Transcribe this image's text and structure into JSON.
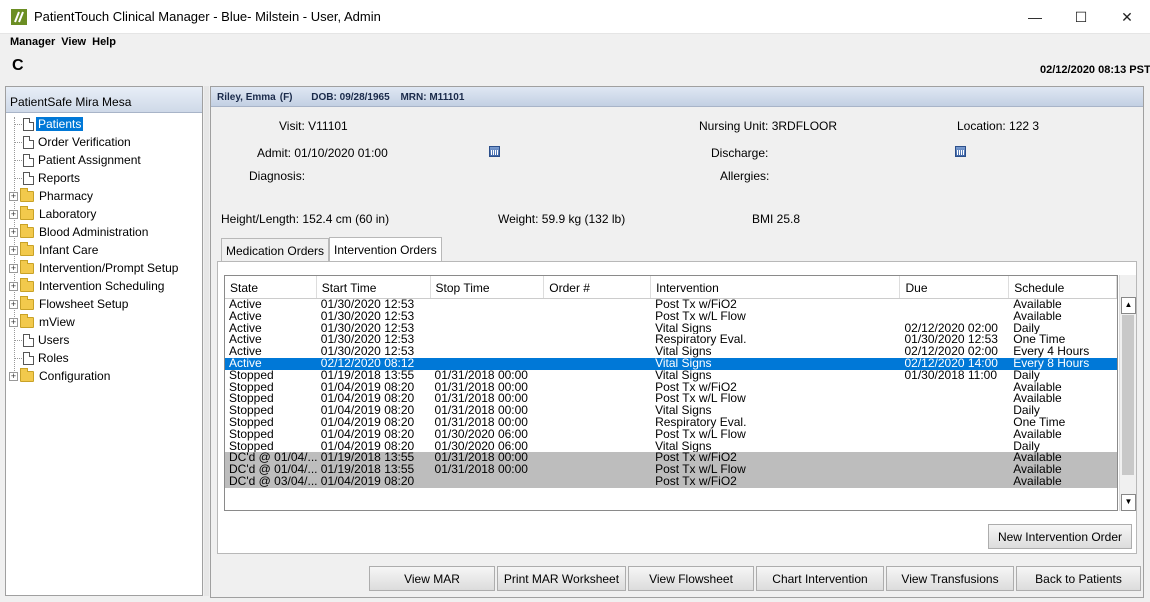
{
  "window": {
    "title": "PatientTouch Clinical Manager - Blue- Milstein - User, Admin",
    "minimize": "—",
    "maximize": "☐",
    "close": "✕"
  },
  "menu": [
    "Manager",
    "View",
    "Help"
  ],
  "toolbar": {
    "refresh_icon": "C",
    "datetime": "02/12/2020 08:13 PST"
  },
  "sidebar": {
    "header": "PatientSafe Mira Mesa",
    "items": [
      {
        "label": "Patients",
        "kind": "doc",
        "selected": true
      },
      {
        "label": "Order Verification",
        "kind": "doc"
      },
      {
        "label": "Patient Assignment",
        "kind": "doc"
      },
      {
        "label": "Reports",
        "kind": "doc"
      },
      {
        "label": "Pharmacy",
        "kind": "folder"
      },
      {
        "label": "Laboratory",
        "kind": "folder"
      },
      {
        "label": "Blood Administration",
        "kind": "folder"
      },
      {
        "label": "Infant Care",
        "kind": "folder"
      },
      {
        "label": "Intervention/Prompt Setup",
        "kind": "folder"
      },
      {
        "label": "Intervention Scheduling",
        "kind": "folder"
      },
      {
        "label": "Flowsheet Setup",
        "kind": "folder"
      },
      {
        "label": "mView",
        "kind": "folder"
      },
      {
        "label": "Users",
        "kind": "doc"
      },
      {
        "label": "Roles",
        "kind": "doc"
      },
      {
        "label": "Configuration",
        "kind": "folder"
      }
    ]
  },
  "patient": {
    "name": "Riley, Emma",
    "sex": "(F)",
    "dob": "DOB: 09/28/1965",
    "mrn": "MRN: M11101",
    "visit": "Visit: V11101",
    "nursing_unit": "Nursing Unit: 3RDFLOOR",
    "location": "Location: 122 3",
    "admit": "Admit: 01/10/2020 01:00",
    "discharge": "Discharge:",
    "diagnosis": "Diagnosis:",
    "allergies": "Allergies:",
    "height": "Height/Length: 152.4 cm (60 in)",
    "weight": "Weight: 59.9 kg (132 lb)",
    "bmi": "BMI 25.8"
  },
  "tabs": [
    {
      "label": "Medication Orders",
      "active": false
    },
    {
      "label": "Intervention Orders",
      "active": true
    }
  ],
  "grid": {
    "columns": [
      "State",
      "Start Time",
      "Stop Time",
      "Order #",
      "Intervention",
      "Due",
      "Schedule"
    ],
    "rows": [
      {
        "cells": [
          "Active",
          "01/30/2020 12:53",
          "",
          "",
          "Post Tx w/FiO2",
          "",
          "Available"
        ]
      },
      {
        "cells": [
          "Active",
          "01/30/2020 12:53",
          "",
          "",
          "Post Tx w/L Flow",
          "",
          "Available"
        ]
      },
      {
        "cells": [
          "Active",
          "01/30/2020 12:53",
          "",
          "",
          "Vital Signs",
          "02/12/2020 02:00",
          "Daily"
        ]
      },
      {
        "cells": [
          "Active",
          "01/30/2020 12:53",
          "",
          "",
          "Respiratory Eval.",
          "01/30/2020 12:53",
          "One Time"
        ]
      },
      {
        "cells": [
          "Active",
          "01/30/2020 12:53",
          "",
          "",
          "Vital Signs",
          "02/12/2020 02:00",
          "Every  4 Hours"
        ]
      },
      {
        "cells": [
          "Active",
          "02/12/2020 08:12",
          "",
          "",
          "Vital Signs",
          "02/12/2020 14:00",
          "Every 8 Hours"
        ],
        "style": "sel"
      },
      {
        "cells": [
          "Stopped",
          "01/19/2018 13:55",
          "01/31/2018 00:00",
          "",
          "Vital Signs",
          "01/30/2018 11:00",
          "Daily"
        ]
      },
      {
        "cells": [
          "Stopped",
          "01/04/2019 08:20",
          "01/31/2018 00:00",
          "",
          "Post Tx w/FiO2",
          "",
          "Available"
        ]
      },
      {
        "cells": [
          "Stopped",
          "01/04/2019 08:20",
          "01/31/2018 00:00",
          "",
          "Post Tx w/L Flow",
          "",
          "Available"
        ]
      },
      {
        "cells": [
          "Stopped",
          "01/04/2019 08:20",
          "01/31/2018 00:00",
          "",
          "Vital Signs",
          "",
          "Daily"
        ]
      },
      {
        "cells": [
          "Stopped",
          "01/04/2019 08:20",
          "01/31/2018 00:00",
          "",
          "Respiratory Eval.",
          "",
          "One Time"
        ]
      },
      {
        "cells": [
          "Stopped",
          "01/04/2019 08:20",
          "01/30/2020 06:00",
          "",
          "Post Tx w/L Flow",
          "",
          "Available"
        ]
      },
      {
        "cells": [
          "Stopped",
          "01/04/2019 08:20",
          "01/30/2020 06:00",
          "",
          "Vital Signs",
          "",
          "Daily"
        ]
      },
      {
        "cells": [
          "DC'd @ 01/04/...",
          "01/19/2018 13:55",
          "01/31/2018 00:00",
          "",
          "Post Tx w/FiO2",
          "",
          "Available"
        ],
        "style": "dc"
      },
      {
        "cells": [
          "DC'd @ 01/04/...",
          "01/19/2018 13:55",
          "01/31/2018 00:00",
          "",
          "Post Tx w/L Flow",
          "",
          "Available"
        ],
        "style": "dc"
      },
      {
        "cells": [
          "DC'd @ 03/04/...",
          "01/04/2019 08:20",
          "",
          "",
          "Post Tx w/FiO2",
          "",
          "Available"
        ],
        "style": "dc"
      }
    ]
  },
  "buttons": {
    "new_intervention": "New Intervention Order",
    "view_mar": "View MAR",
    "print_mar": "Print MAR Worksheet",
    "view_flowsheet": "View Flowsheet",
    "chart_intervention": "Chart Intervention",
    "view_transfusions": "View Transfusions",
    "back": "Back to Patients"
  },
  "colors": {
    "selection": "#0078d7",
    "dc_row": "#bdbdbd",
    "banner": "#c3d0e3"
  }
}
